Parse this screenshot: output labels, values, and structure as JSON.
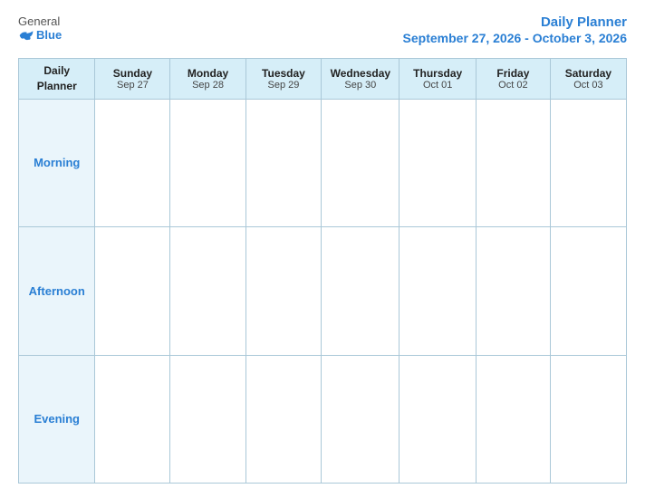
{
  "header": {
    "logo_general": "General",
    "logo_blue": "Blue",
    "planner_title": "Daily Planner",
    "date_range": "September 27, 2026 - October 3, 2026"
  },
  "table": {
    "label_header_line1": "Daily",
    "label_header_line2": "Planner",
    "columns": [
      {
        "day": "Sunday",
        "date": "Sep 27"
      },
      {
        "day": "Monday",
        "date": "Sep 28"
      },
      {
        "day": "Tuesday",
        "date": "Sep 29"
      },
      {
        "day": "Wednesday",
        "date": "Sep 30"
      },
      {
        "day": "Thursday",
        "date": "Oct 01"
      },
      {
        "day": "Friday",
        "date": "Oct 02"
      },
      {
        "day": "Saturday",
        "date": "Oct 03"
      }
    ],
    "rows": [
      {
        "label": "Morning"
      },
      {
        "label": "Afternoon"
      },
      {
        "label": "Evening"
      }
    ]
  }
}
